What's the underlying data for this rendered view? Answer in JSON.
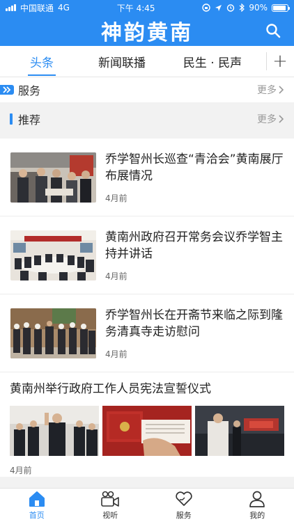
{
  "status_bar": {
    "carrier": "中国联通",
    "network": "4G",
    "time": "下午 4:45",
    "battery": "90%",
    "battery_level": 0.9
  },
  "header": {
    "title": "神韵黄南",
    "search_icon": "search-icon"
  },
  "tabs": [
    {
      "label": "头条",
      "active": true
    },
    {
      "label": "新闻联播",
      "active": false
    },
    {
      "label": "民生 · 民声",
      "active": false
    }
  ],
  "add_tab_label": "+",
  "services": {
    "title": "服务",
    "more": "更多"
  },
  "recommend": {
    "title": "推荐",
    "more": "更多"
  },
  "news": [
    {
      "title": "乔学智州长巡查“青洽会”黄南展厅布展情况",
      "time": "4月前"
    },
    {
      "title": "黄南州政府召开常务会议乔学智主持并讲话",
      "time": "4月前"
    },
    {
      "title": "乔学智州长在开斋节来临之际到隆务清真寺走访慰问",
      "time": "4月前"
    }
  ],
  "multi_news": {
    "title": "黄南州举行政府工作人员宪法宣誓仪式",
    "time": "4月前"
  },
  "bottom_nav": [
    {
      "label": "首页",
      "icon": "home-icon",
      "active": true
    },
    {
      "label": "视听",
      "icon": "video-camera-icon",
      "active": false
    },
    {
      "label": "服务",
      "icon": "heart-hand-icon",
      "active": false
    },
    {
      "label": "我的",
      "icon": "person-icon",
      "active": false
    }
  ],
  "colors": {
    "brand": "#2b8cf2"
  }
}
